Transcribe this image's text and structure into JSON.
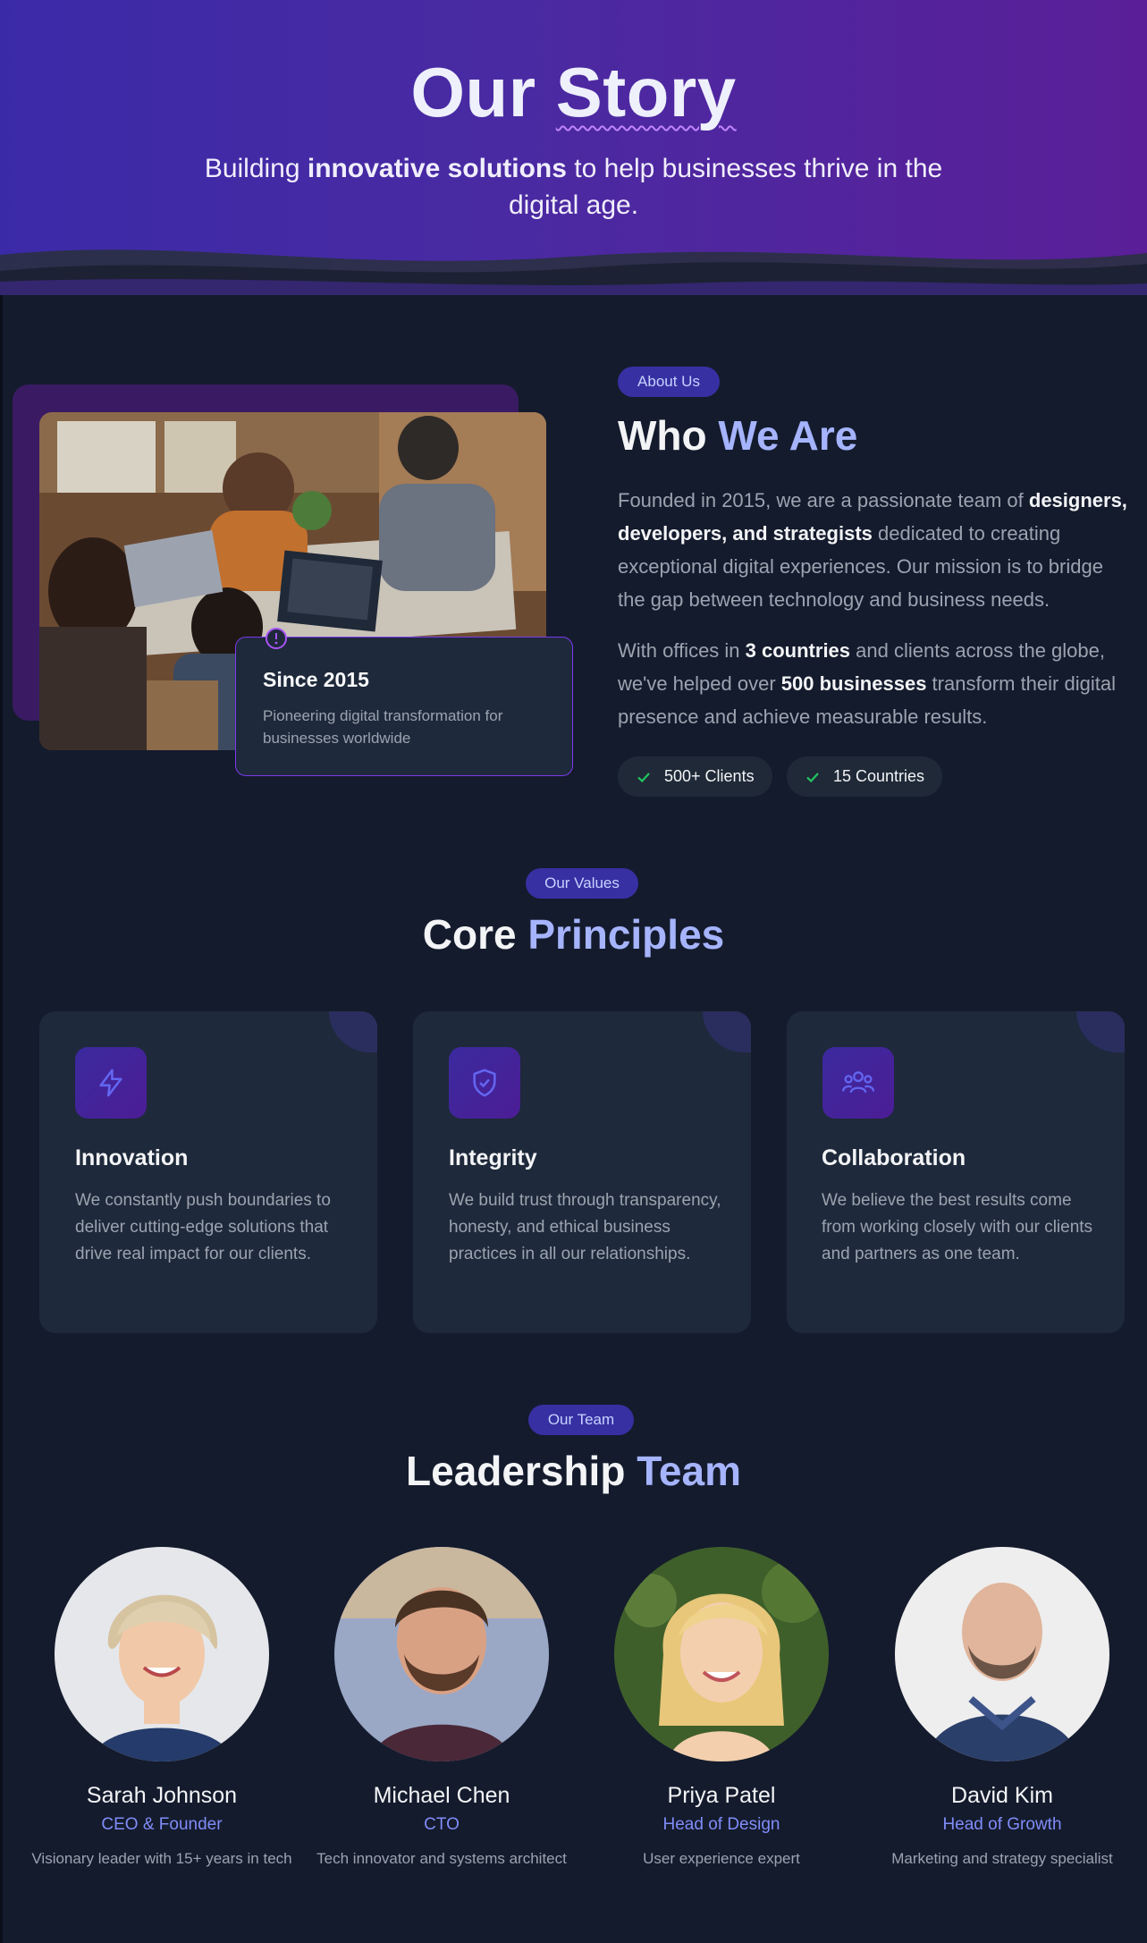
{
  "hero": {
    "title_part1": "Our ",
    "title_part2": "Story",
    "subtitle_pre": "Building ",
    "subtitle_bold": "innovative solutions",
    "subtitle_post": " to help businesses thrive in the digital age."
  },
  "about": {
    "pill": "About Us",
    "heading_main": "Who ",
    "heading_accent": "We Are",
    "since_title": "Since 2015",
    "since_text": "Pioneering digital transformation for businesses worldwide",
    "p1_a": "Founded in 2015, we are a passionate team of ",
    "p1_b": "designers, developers, and strategists",
    "p1_c": " dedicated to creating exceptional digital experiences. Our mission is to bridge the gap between technology and business needs.",
    "p2_a": "With offices in ",
    "p2_b": "3 countries",
    "p2_c": " and clients across the globe, we've helped over ",
    "p2_d": "500 businesses",
    "p2_e": " transform their digital presence and achieve measurable results.",
    "stats": [
      "500+ Clients",
      "15 Countries"
    ]
  },
  "values": {
    "pill": "Our Values",
    "heading_main": "Core ",
    "heading_accent": "Principles",
    "items": [
      {
        "title": "Innovation",
        "icon": "lightning-icon",
        "desc": "We constantly push boundaries to deliver cutting-edge solutions that drive real impact for our clients."
      },
      {
        "title": "Integrity",
        "icon": "shield-check-icon",
        "desc": "We build trust through transparency, honesty, and ethical business practices in all our relationships."
      },
      {
        "title": "Collaboration",
        "icon": "people-icon",
        "desc": "We believe the best results come from working closely with our clients and partners as one team."
      }
    ]
  },
  "team": {
    "pill": "Our Team",
    "heading_main": "Leadership ",
    "heading_accent": "Team",
    "members": [
      {
        "name": "Sarah Johnson",
        "role": "CEO & Founder",
        "bio": "Visionary leader with 15+ years in tech"
      },
      {
        "name": "Michael Chen",
        "role": "CTO",
        "bio": "Tech innovator and systems architect"
      },
      {
        "name": "Priya Patel",
        "role": "Head of Design",
        "bio": "User experience expert"
      },
      {
        "name": "David Kim",
        "role": "Head of Growth",
        "bio": "Marketing and strategy specialist"
      }
    ]
  },
  "colors": {
    "accent": "#a5b4fc",
    "pill_bg": "#3730a3",
    "card_bg": "#1e293b",
    "page_bg": "#141b2d",
    "check": "#22c55e"
  }
}
